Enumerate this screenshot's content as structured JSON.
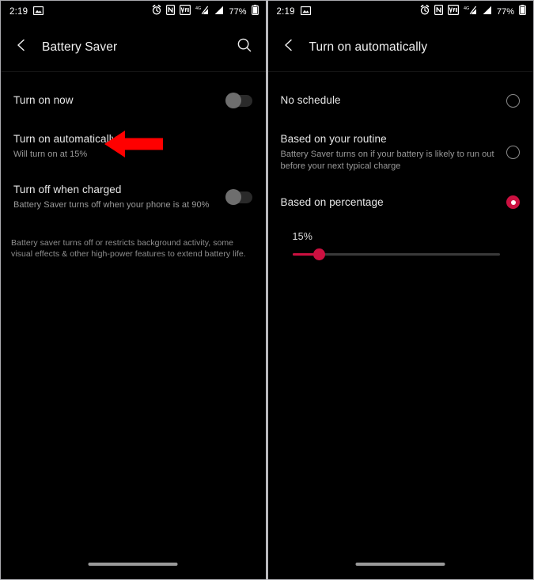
{
  "status_bar": {
    "time": "2:19",
    "battery_percent": "77%",
    "icons": [
      "screenshot-image-icon",
      "alarm-icon",
      "nfc-icon",
      "vowifi-icon",
      "mobile-data-4g-slash-icon",
      "signal-bars-icon",
      "battery-icon"
    ]
  },
  "left_screen": {
    "appbar": {
      "back_icon": "back-chevron-icon",
      "title": "Battery Saver",
      "search_icon": "search-icon"
    },
    "rows": [
      {
        "title": "Turn on now",
        "subtitle": "",
        "control": "switch",
        "checked": false
      },
      {
        "title": "Turn on automatically",
        "subtitle": "Will turn on at 15%",
        "control": "none",
        "checked": false
      },
      {
        "title": "Turn off when charged",
        "subtitle": "Battery Saver turns off when your phone is at 90%",
        "control": "switch",
        "checked": false
      }
    ],
    "footnote": "Battery saver turns off or restricts background activity, some visual effects & other high-power features to extend battery life.",
    "annotation": {
      "type": "arrow-left",
      "color": "#FF0000",
      "points_at": "Turn on automatically"
    }
  },
  "right_screen": {
    "appbar": {
      "back_icon": "back-chevron-icon",
      "title": "Turn on automatically"
    },
    "options": [
      {
        "title": "No schedule",
        "subtitle": "",
        "selected": false
      },
      {
        "title": "Based on your routine",
        "subtitle": "Battery Saver turns on if your battery is likely to run out before your next typical charge",
        "selected": false
      },
      {
        "title": "Based on percentage",
        "subtitle": "",
        "selected": true
      }
    ],
    "slider": {
      "value_label": "15%",
      "fill_percent": 13
    }
  },
  "theme": {
    "accent": "#CC1040",
    "background": "#000000",
    "primary_text": "#E8E8E8",
    "secondary_text": "#9A9A9A",
    "annotation_red": "#FF0000"
  }
}
